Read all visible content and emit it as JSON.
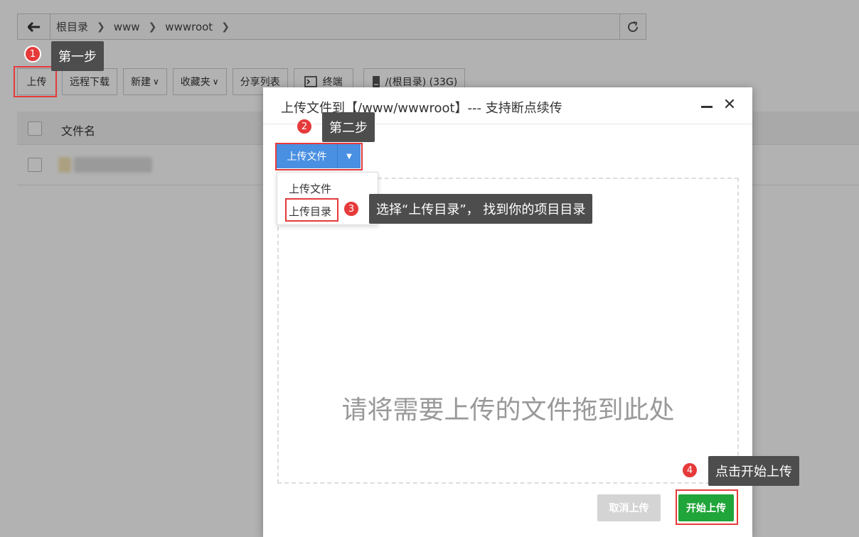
{
  "pathbar": {
    "crumbs": [
      "根目录",
      "www",
      "wwwroot"
    ]
  },
  "toolbar": {
    "upload": "上传",
    "remote_download": "远程下载",
    "new": "新建",
    "favorites": "收藏夹",
    "share_list": "分享列表",
    "terminal": "终端",
    "disk": "/(根目录) (33G)"
  },
  "table": {
    "col_filename": "文件名"
  },
  "dialog": {
    "title": "上传文件到【/www/wwwroot】--- 支持断点续传",
    "upload_button": "上传文件",
    "menu": [
      "上传文件",
      "上传目录"
    ],
    "dropzone_text": "请将需要上传的文件拖到此处",
    "cancel_button": "取消上传",
    "start_button": "开始上传"
  },
  "callouts": {
    "step1": {
      "num": "1",
      "text": "第一步"
    },
    "step2": {
      "num": "2",
      "text": "第二步"
    },
    "step3": {
      "num": "3",
      "text": "选择“上传目录”， 找到你的项目目录"
    },
    "step4": {
      "num": "4",
      "text": "点击开始上传"
    }
  },
  "colors": {
    "accent_blue": "#4a90e2",
    "start_green": "#20a53a",
    "callout_red": "#e63a3a",
    "tooltip_gray": "#4d4d4d"
  }
}
